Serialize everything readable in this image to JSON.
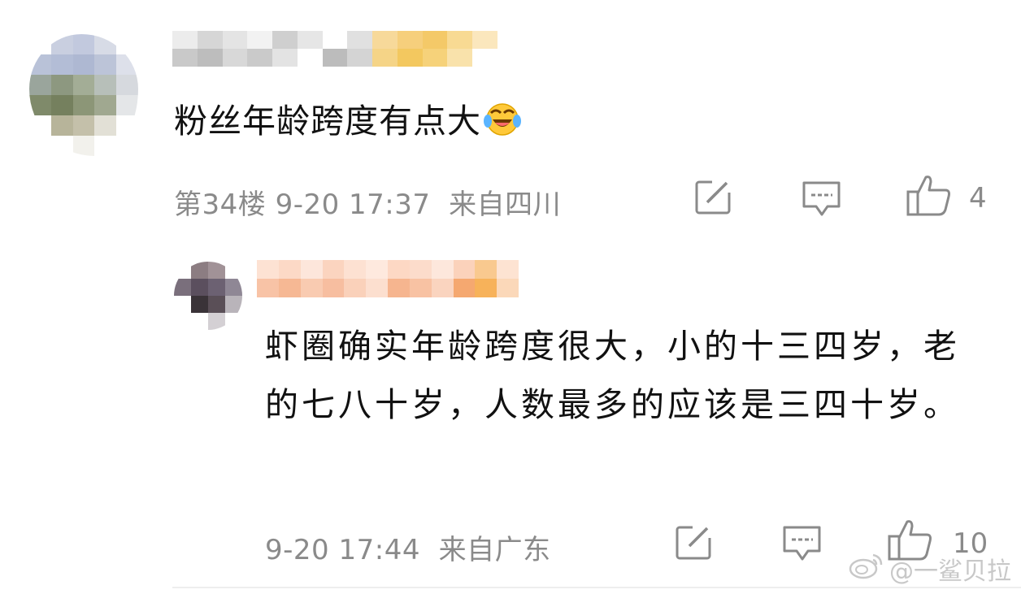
{
  "comment": {
    "text": "粉丝年龄跨度有点大",
    "emoji": "laughing-crying-emoji",
    "floor_time": "第34楼 9-20 17:37",
    "location": "来自四川",
    "likes": "4"
  },
  "reply": {
    "text": "虾圈确实年龄跨度很大，小的十三四岁，老的七八十岁，人数最多的应该是三四十岁。",
    "time": "9-20 17:44",
    "location": "来自广东",
    "likes": "10"
  },
  "watermark": {
    "text": "@一鲨贝拉",
    "icon": "weibo-icon"
  },
  "icons": {
    "share": "share-edit-icon",
    "comment": "comment-bubble-icon",
    "like": "thumbs-up-icon"
  },
  "colors": {
    "text": "#111111",
    "meta": "#8a8a8a",
    "icon": "#8a8a8a"
  }
}
